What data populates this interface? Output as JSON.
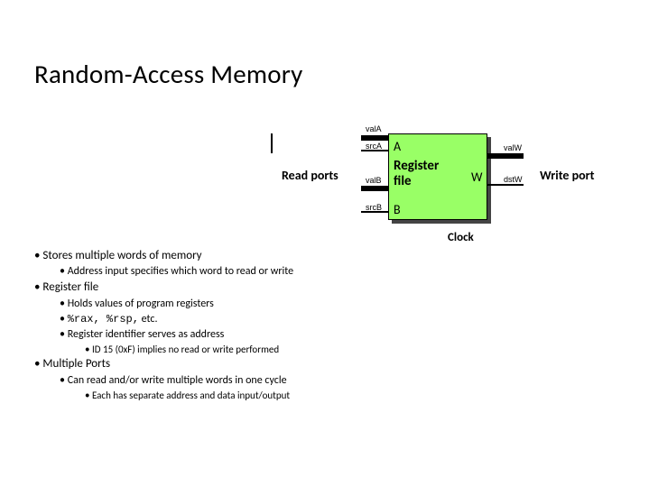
{
  "title": "Random-Access Memory",
  "diagram": {
    "box_label_1": "Register",
    "box_label_2": "file",
    "port_a": "A",
    "port_b": "B",
    "port_w": "W",
    "pin_valA": "valA",
    "pin_srcA": "srcA",
    "pin_valB": "valB",
    "pin_srcB": "srcB",
    "pin_valW": "valW",
    "pin_dstW": "dstW",
    "read_label": "Read ports",
    "write_label": "Write port",
    "clock_label": "Clock"
  },
  "bullets": {
    "l1a": "Stores multiple words of memory",
    "l2a": "Address input specifies which word to read or write",
    "l1b": "Register file",
    "l2b": "Holds values of program registers",
    "l2c_prefix": "",
    "l2c_code": "%rax, %rsp,",
    "l2c_suffix": " etc.",
    "l2d": "Register identifier serves as address",
    "l3a": "ID 15 (0xF) implies no read or write performed",
    "l1c": "Multiple Ports",
    "l2e": "Can read and/or write multiple words in one cycle",
    "l3b": "Each has separate address and data input/output"
  }
}
